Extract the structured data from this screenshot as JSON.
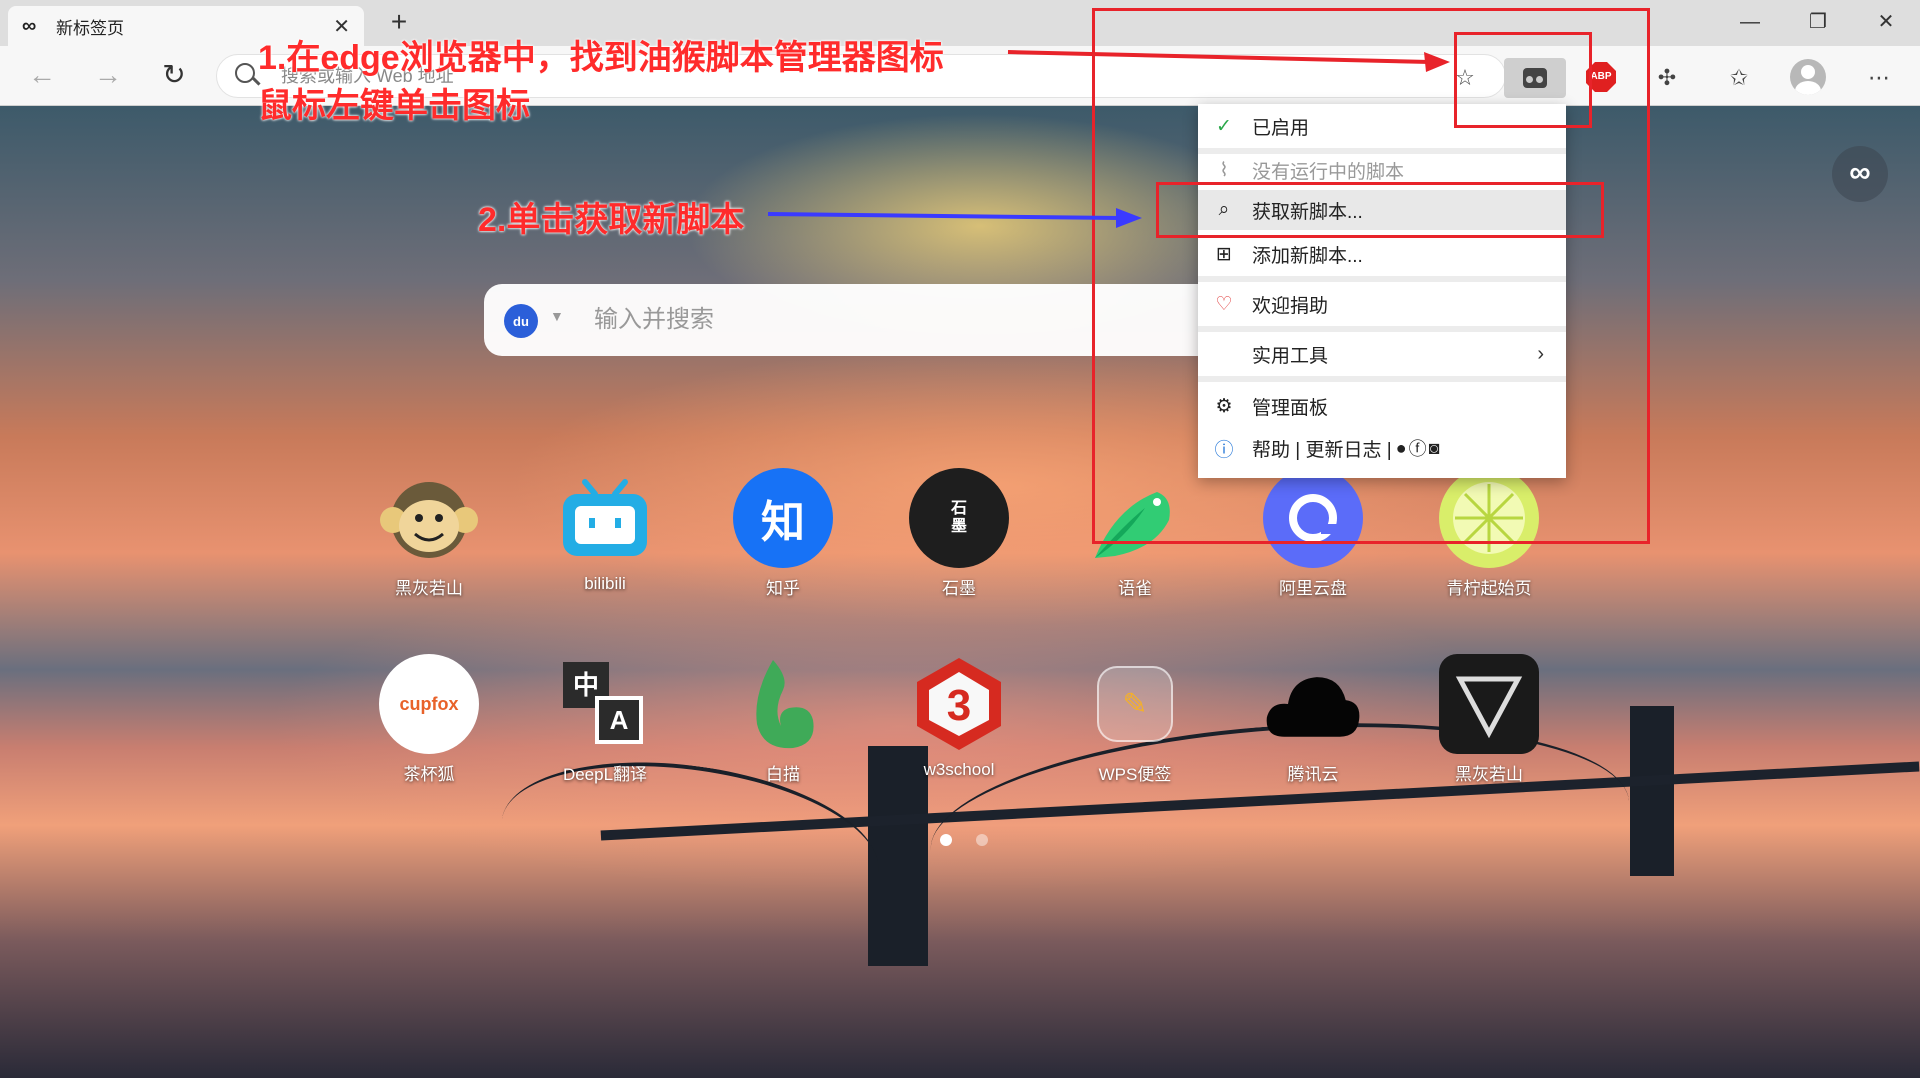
{
  "tab": {
    "icon": "infinity-icon",
    "title": "新标签页"
  },
  "toolbar": {
    "address_placeholder": "搜索或输入 Web 地址",
    "extension_badge": "ABP"
  },
  "searchbox": {
    "engine_label": "du",
    "placeholder": "输入并搜索"
  },
  "menu": {
    "items": [
      {
        "icon": "check-icon",
        "label": "已启用"
      },
      {
        "icon": "script-icon",
        "label": "没有运行中的脚本"
      },
      {
        "icon": "search-icon",
        "label": "获取新脚本..."
      },
      {
        "icon": "plus-square-icon",
        "label": "添加新脚本..."
      },
      {
        "icon": "heart-icon",
        "label": "欢迎捐助"
      },
      {
        "icon": "",
        "label": "实用工具"
      },
      {
        "icon": "gear-icon",
        "label": "管理面板"
      },
      {
        "icon": "info-icon",
        "label": "帮助 | 更新日志 |"
      }
    ]
  },
  "shortcuts": {
    "row1": [
      "黑灰若山",
      "bilibili",
      "知乎",
      "石墨",
      "语雀",
      "阿里云盘",
      "青柠起始页"
    ],
    "row2": [
      "茶杯狐",
      "DeepL翻译",
      "白描",
      "w3school",
      "WPS便签",
      "腾讯云",
      "黑灰若山"
    ],
    "icon_text": {
      "zhihu": "知",
      "shimo": "石\n墨",
      "cupfox": "cupfox",
      "deepl_1": "中",
      "deepl_2": "A",
      "w3": "3"
    }
  },
  "annotations": {
    "step1_line1": "1.在edge浏览器中，找到油猴脚本管理器图标",
    "step1_line2": "鼠标左键单击图标",
    "step2": "2.单击获取新脚本"
  },
  "colors": {
    "annotation_red": "#e8232a",
    "arrow_blue": "#3a3aff",
    "menu_check": "#2aa84a",
    "heart": "#e03a3a",
    "info": "#2b7bd9"
  }
}
